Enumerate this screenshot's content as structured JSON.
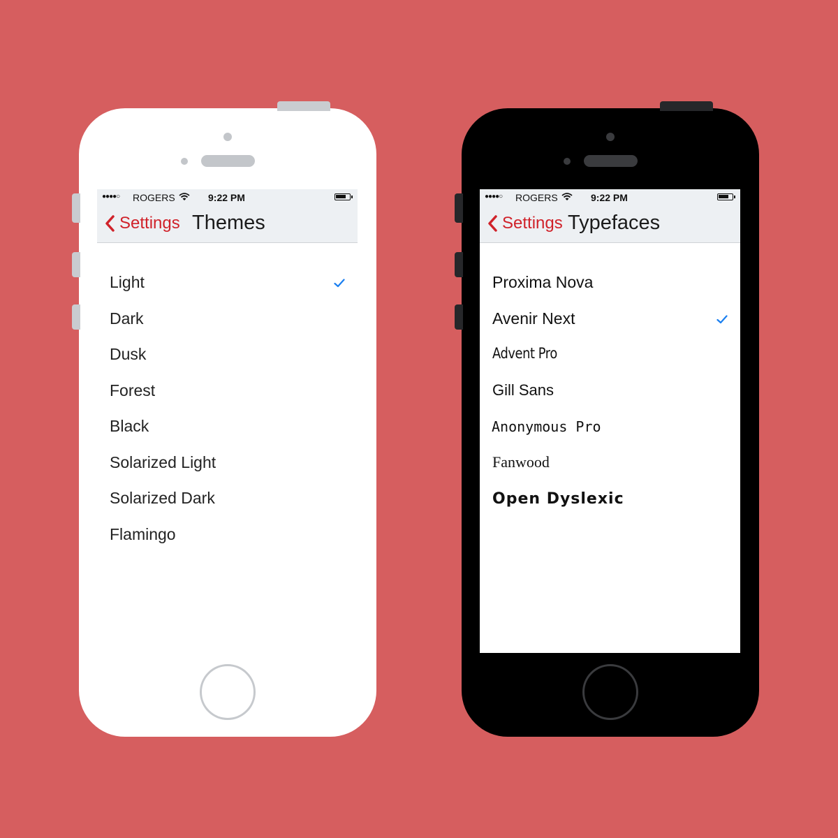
{
  "status": {
    "signal": "●●●●○",
    "carrier": "ROGERS",
    "wifi_icon": "wifi-icon",
    "time": "9:22 PM"
  },
  "themes_screen": {
    "back_label": "Settings",
    "title": "Themes",
    "items": [
      {
        "label": "Light",
        "selected": true
      },
      {
        "label": "Dark",
        "selected": false
      },
      {
        "label": "Dusk",
        "selected": false
      },
      {
        "label": "Forest",
        "selected": false
      },
      {
        "label": "Black",
        "selected": false
      },
      {
        "label": "Solarized Light",
        "selected": false
      },
      {
        "label": "Solarized Dark",
        "selected": false
      },
      {
        "label": "Flamingo",
        "selected": false
      }
    ]
  },
  "typefaces_screen": {
    "back_label": "Settings",
    "title": "Typefaces",
    "items": [
      {
        "label": "Proxima Nova",
        "selected": false
      },
      {
        "label": "Avenir Next",
        "selected": true
      },
      {
        "label": "Advent Pro",
        "selected": false
      },
      {
        "label": "Gill Sans",
        "selected": false
      },
      {
        "label": "Anonymous Pro",
        "selected": false
      },
      {
        "label": "Fanwood",
        "selected": false
      },
      {
        "label": "Open Dyslexic",
        "selected": false
      }
    ]
  },
  "colors": {
    "background": "#d65e5f",
    "accent_red": "#d0222a",
    "checkmark_blue": "#1a7ff0",
    "bar_gray": "#edf0f3"
  }
}
